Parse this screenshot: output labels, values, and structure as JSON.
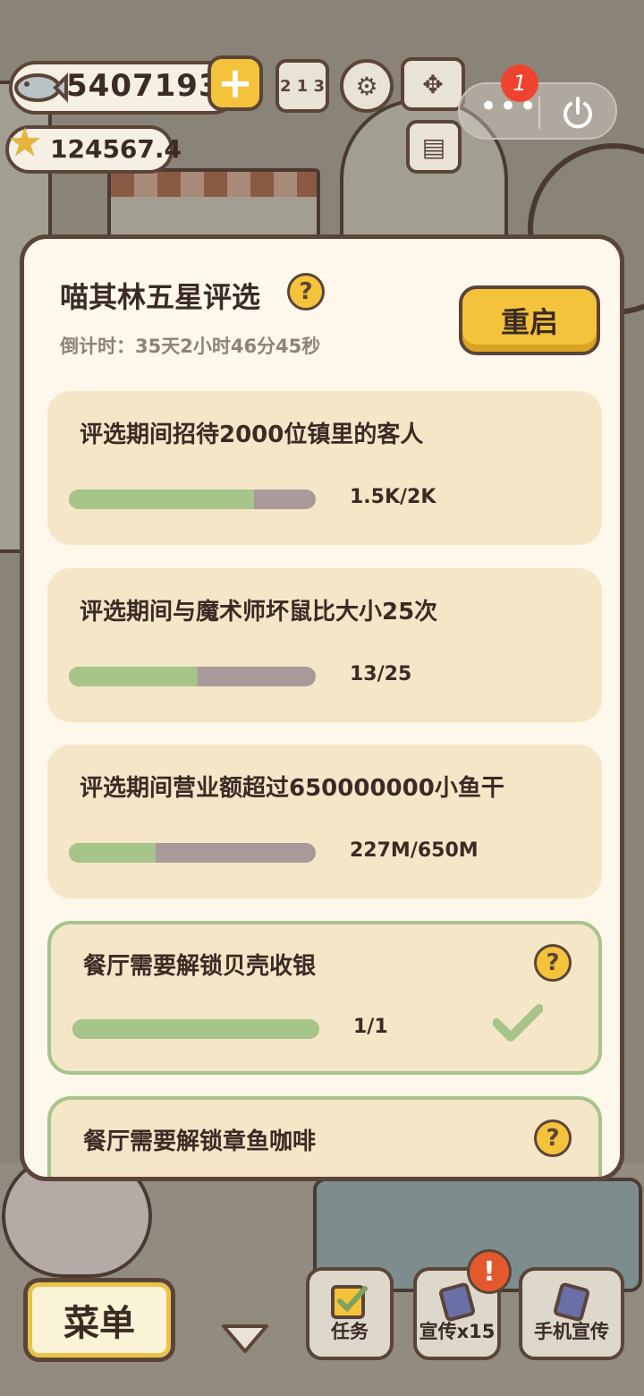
{
  "hud": {
    "fish_currency": "5407193",
    "star_currency": "124567.4",
    "ranking_label": "2 1 3",
    "notification_count": "1",
    "more_dots": "•••"
  },
  "panel": {
    "title": "喵其林五星评选",
    "help_glyph": "?",
    "countdown": "倒计时：35天2小时46分45秒",
    "restart_label": "重启",
    "tasks": [
      {
        "label": "评选期间招待2000位镇里的客人",
        "progress_text": "1.5K/2K",
        "progress": 0.75,
        "completed": false
      },
      {
        "label": "评选期间与魔术师坏鼠比大小25次",
        "progress_text": "13/25",
        "progress": 0.52,
        "completed": false
      },
      {
        "label": "评选期间营业额超过650000000小鱼干",
        "progress_text": "227M/650M",
        "progress": 0.35,
        "completed": false
      },
      {
        "label": "餐厅需要解锁贝壳收银",
        "progress_text": "1/1",
        "progress": 1.0,
        "completed": true
      },
      {
        "label": "餐厅需要解锁章鱼咖啡",
        "progress_text": "",
        "progress": 0,
        "completed": false
      }
    ]
  },
  "bottom_bar": {
    "menu_label": "菜单",
    "tasks_label": "任务",
    "promo_label": "宣传x15",
    "phone_promo_label": "手机宣传",
    "alert_glyph": "!"
  },
  "colors": {
    "accent_yellow": "#f5c33b",
    "progress_green": "#a7c48a",
    "track_gray": "#a79a98",
    "card_bg": "#f5e6c8",
    "outline_brown": "#5b4438"
  }
}
